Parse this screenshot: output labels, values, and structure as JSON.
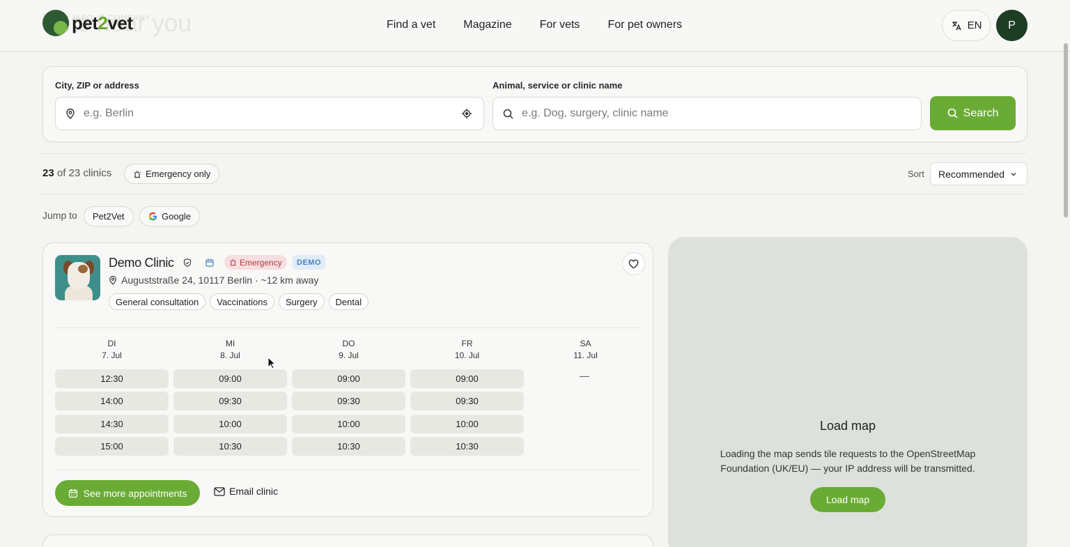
{
  "header": {
    "ghost_title": "Vets near you",
    "ghost_overline": "ABOUT COMPANY",
    "logo": {
      "pre": "pet",
      "two": "2",
      "post": "vet"
    },
    "nav": [
      "Find a vet",
      "Magazine",
      "For vets",
      "For pet owners"
    ],
    "language": "EN",
    "avatar_initial": "P"
  },
  "search": {
    "location_label": "City, ZIP or address",
    "location_placeholder": "e.g. Berlin",
    "query_label": "Animal, service or clinic name",
    "query_placeholder": "e.g. Dog, surgery, clinic name",
    "button": "Search"
  },
  "results": {
    "count_shown": "23",
    "count_of": "of 23 clinics",
    "emergency_filter": "Emergency only",
    "sort_label": "Sort",
    "sort_value": "Recommended",
    "jump_label": "Jump to",
    "jump_links": [
      "Pet2Vet",
      "Google"
    ]
  },
  "clinic": {
    "name": "Demo Clinic",
    "emergency_badge": "Emergency",
    "demo_badge": "DEMO",
    "address": "Auguststraße 24, 10117 Berlin · ~12 km away",
    "tags": [
      "General consultation",
      "Vaccinations",
      "Surgery",
      "Dental"
    ],
    "days": [
      {
        "dow": "DI",
        "date": "7. Jul",
        "slots": [
          "12:30",
          "14:00",
          "14:30",
          "15:00"
        ]
      },
      {
        "dow": "MI",
        "date": "8. Jul",
        "slots": [
          "09:00",
          "09:30",
          "10:00",
          "10:30"
        ]
      },
      {
        "dow": "DO",
        "date": "9. Jul",
        "slots": [
          "09:00",
          "09:30",
          "10:00",
          "10:30"
        ]
      },
      {
        "dow": "FR",
        "date": "10. Jul",
        "slots": [
          "09:00",
          "09:30",
          "10:00",
          "10:30"
        ]
      },
      {
        "dow": "SA",
        "date": "11. Jul",
        "slots": []
      }
    ],
    "no_slots": "—",
    "more_button": "See more appointments",
    "email_button": "Email clinic"
  },
  "map": {
    "title": "Load map",
    "text": "Loading the map sends tile requests to the OpenStreetMap Foundation (UK/EU) — your IP address will be transmitted.",
    "button": "Load map"
  },
  "colors": {
    "accent": "#6aab35",
    "brand_dark": "#1e3d25",
    "emergency": "#b23a44",
    "demo": "#4a85bd"
  }
}
